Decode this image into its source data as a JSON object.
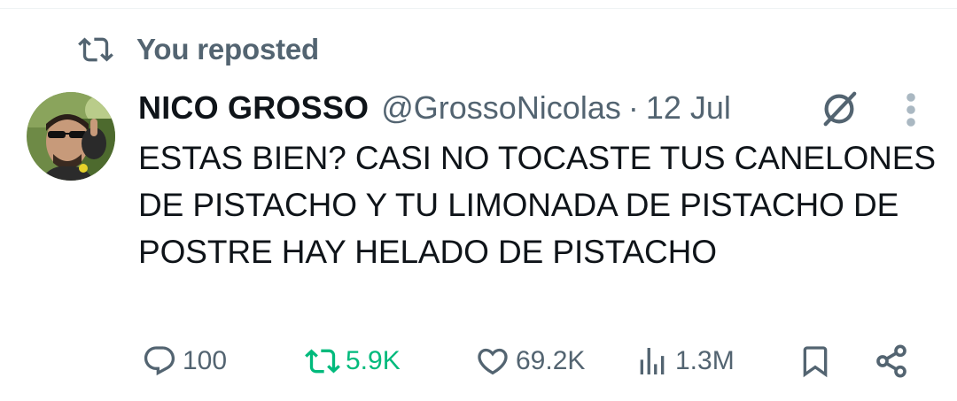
{
  "repost_header": {
    "icon": "repost-icon",
    "label": "You reposted"
  },
  "tweet": {
    "author": {
      "display_name": "NICO GROSSO",
      "handle": "@GrossoNicolas",
      "avatar": "avatar-photo"
    },
    "separator": "·",
    "date": "12 Jul",
    "header_icons": [
      "grok-icon",
      "more-icon"
    ],
    "text": "ESTAS BIEN? CASI NO TOCASTE TUS CANELONES DE PISTACHO Y TU LIMONADA DE PISTACHO DE POSTRE HAY HELADO DE PISTACHO",
    "stats": {
      "replies": "100",
      "reposts": "5.9K",
      "likes": "69.2K",
      "views": "1.3M"
    },
    "action_icons": [
      "reply-icon",
      "repost-icon",
      "like-icon",
      "views-icon",
      "bookmark-icon",
      "share-icon"
    ]
  },
  "colors": {
    "text_primary": "#0f1419",
    "text_secondary": "#536471",
    "repost_active": "#00ba7c",
    "divider": "#eff3f4"
  }
}
